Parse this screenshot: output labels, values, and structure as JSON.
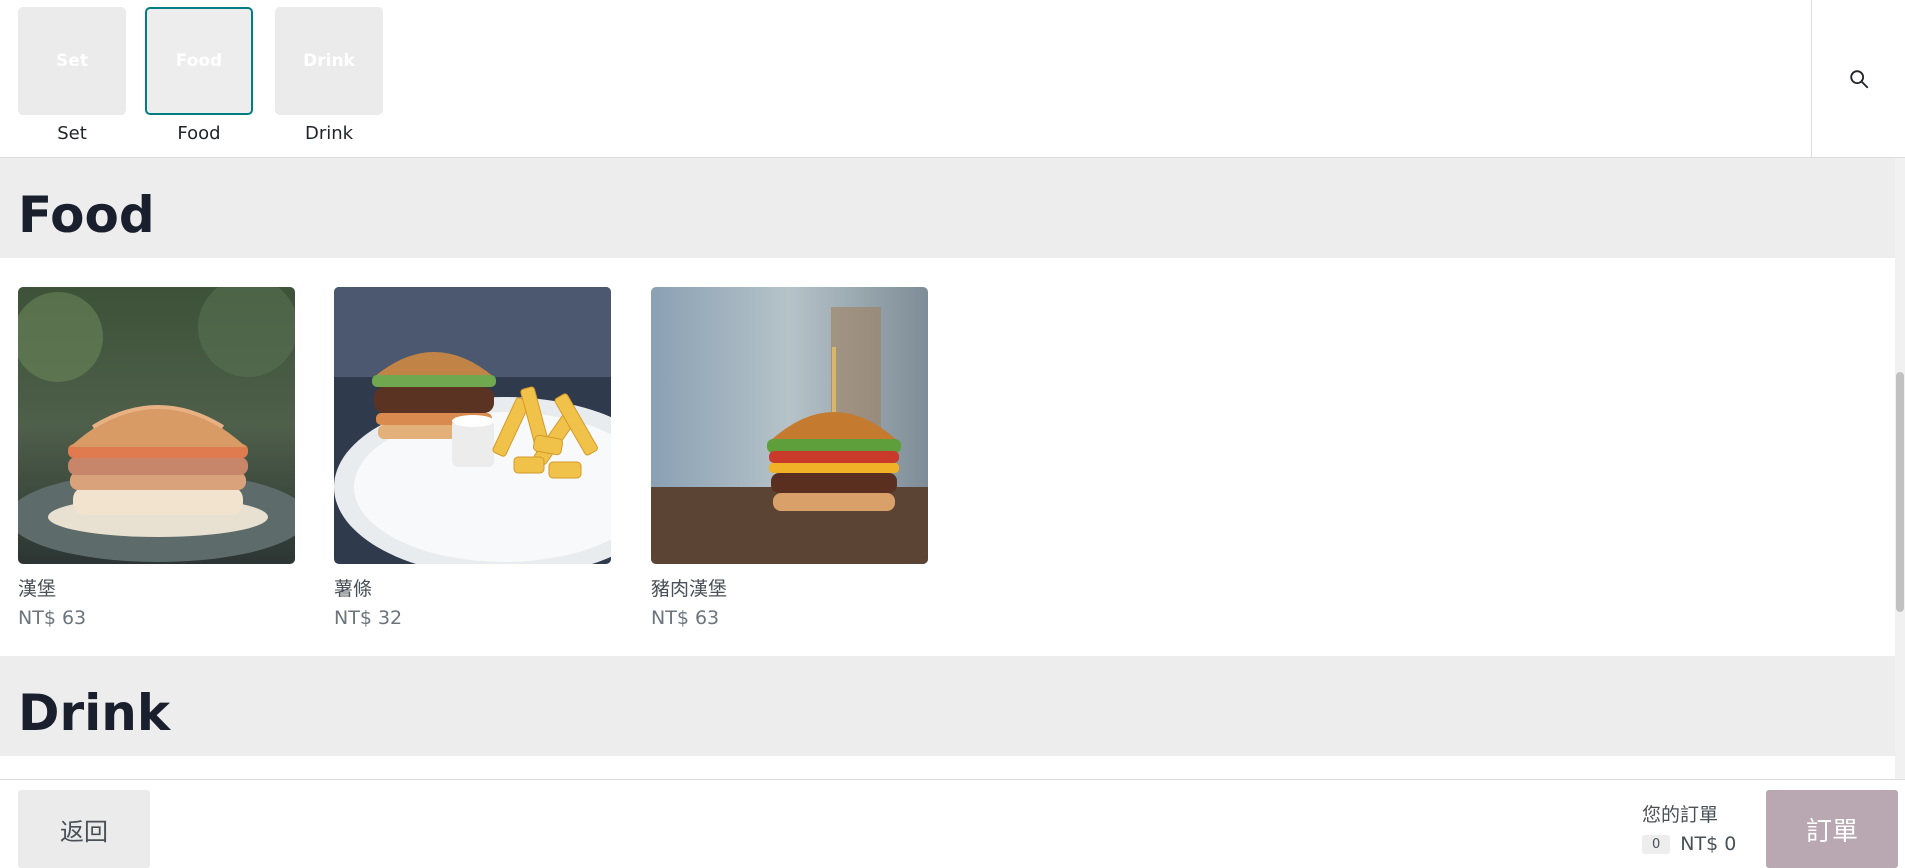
{
  "categories": [
    {
      "tile_text": "Set",
      "label": "Set",
      "active": false
    },
    {
      "tile_text": "Food",
      "label": "Food",
      "active": true
    },
    {
      "tile_text": "Drink",
      "label": "Drink",
      "active": false
    }
  ],
  "search": {
    "icon": "search-icon"
  },
  "sections": {
    "food": {
      "title": "Food"
    },
    "drink": {
      "title": "Drink"
    }
  },
  "products": [
    {
      "name": "漢堡",
      "price": "NT$ 63",
      "image": "burger-photo"
    },
    {
      "name": "薯條",
      "price": "NT$ 32",
      "image": "burger-fries-photo"
    },
    {
      "name": "豬肉漢堡",
      "price": "NT$ 63",
      "image": "pork-burger-photo"
    }
  ],
  "footer": {
    "back_label": "返回",
    "order_summary_label": "您的訂單",
    "item_count": "0",
    "total": "NT$ 0",
    "order_label": "訂單"
  },
  "colors": {
    "accent": "#017e84",
    "order_button": "#b9a7b2",
    "section_bg": "#ededed"
  }
}
